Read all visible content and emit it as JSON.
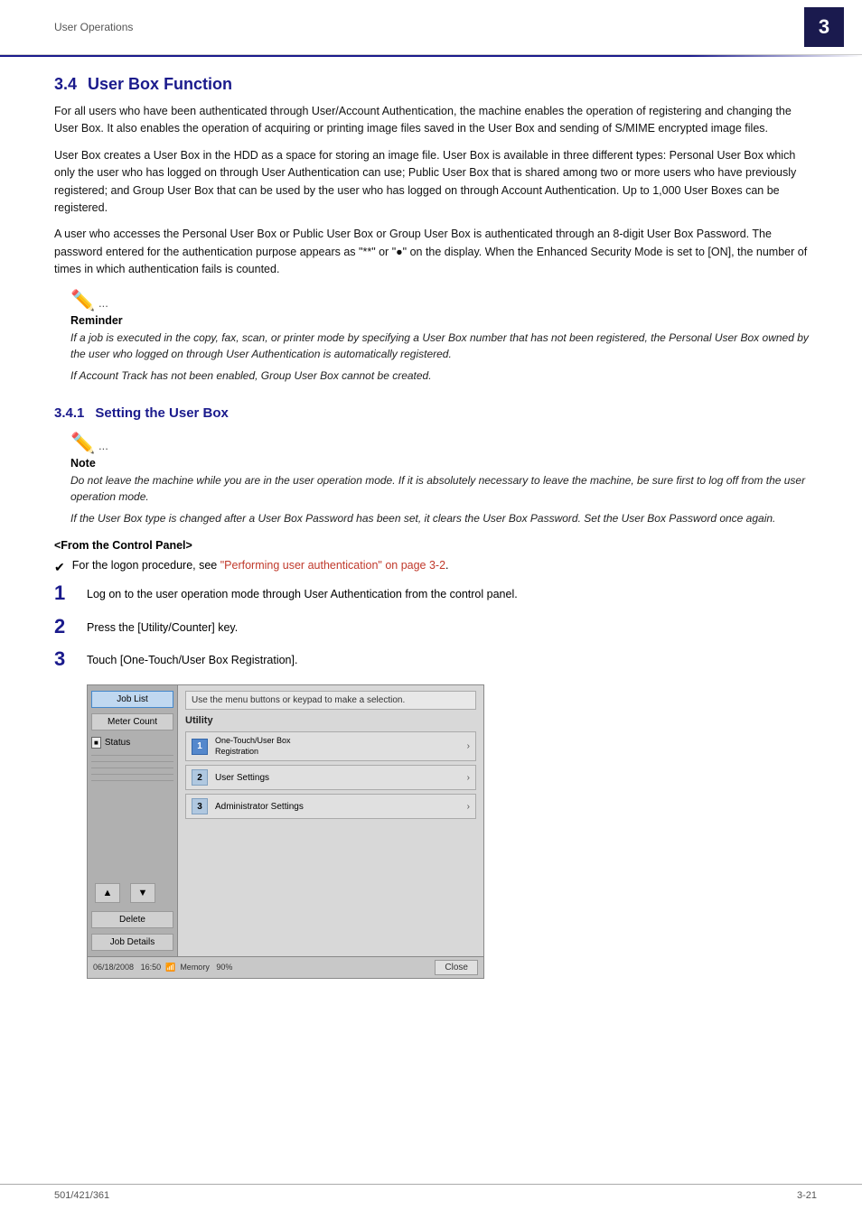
{
  "header": {
    "page_label": "User Operations",
    "chapter_number": "3"
  },
  "section": {
    "number": "3.4",
    "title": "User Box Function",
    "paragraphs": [
      "For all users who have been authenticated through User/Account Authentication, the machine enables the operation of registering and changing the User Box. It also enables the operation of acquiring or printing image files saved in the User Box and sending of S/MIME encrypted image files.",
      "User Box creates a User Box in the HDD as a space for storing an image file. User Box is available in three different types: Personal User Box which only the user who has logged on through User Authentication can use; Public User Box that is shared among two or more users who have previously registered; and Group User Box that can be used by the user who has logged on through Account Authentication. Up to 1,000 User Boxes can be registered.",
      "A user who accesses the Personal User Box or Public User Box or Group User Box is authenticated through an 8-digit User Box Password. The password entered for the authentication purpose appears as \"**\" or \"●\" on the display. When the Enhanced Security Mode is set to [ON], the number of times in which authentication fails is counted."
    ],
    "reminder": {
      "label": "Reminder",
      "items": [
        "If a job is executed in the copy, fax, scan, or printer mode by specifying a User Box number that has not been registered, the Personal User Box owned by the user who logged on through User Authentication is automatically registered.",
        "If Account Track has not been enabled, Group User Box cannot be created."
      ]
    }
  },
  "subsection": {
    "number": "3.4.1",
    "title": "Setting the User Box",
    "note": {
      "label": "Note",
      "items": [
        "Do not leave the machine while you are in the user operation mode. If it is absolutely necessary to leave the machine, be sure first to log off from the user operation mode.",
        "If the User Box type is changed after a User Box Password has been set, it clears the User Box Password. Set the User Box Password once again."
      ]
    },
    "control_panel_label": "<From the Control Panel>",
    "check_item": {
      "symbol": "✔",
      "text": "For the logon procedure, see ",
      "link": "\"Performing user authentication\" on page 3-2",
      "link_suffix": "."
    },
    "steps": [
      {
        "number": "1",
        "text": "Log on to the user operation mode through User Authentication from the control panel."
      },
      {
        "number": "2",
        "text": "Press the [Utility/Counter] key."
      },
      {
        "number": "3",
        "text": "Touch [One-Touch/User Box Registration]."
      }
    ],
    "machine_ui": {
      "top_message": "Use the menu buttons or keypad to make a selection.",
      "utility_label": "Utility",
      "left_buttons": [
        "Job List",
        "Meter Count"
      ],
      "status_label": "Status",
      "menu_items": [
        {
          "num": "1",
          "label": "One-Touch/User Box\nRegistration",
          "highlighted": true
        },
        {
          "num": "2",
          "label": "User Settings"
        },
        {
          "num": "3",
          "label": "Administrator Settings"
        }
      ],
      "bottom_buttons": [
        "▲",
        "▼"
      ],
      "action_buttons": [
        "Delete",
        "Job Details"
      ],
      "footer_date": "06/18/2008",
      "footer_time": "16:50",
      "footer_memory": "Memory",
      "footer_memory_val": "90%",
      "close_button": "Close"
    }
  },
  "footer": {
    "left": "501/421/361",
    "right": "3-21"
  }
}
